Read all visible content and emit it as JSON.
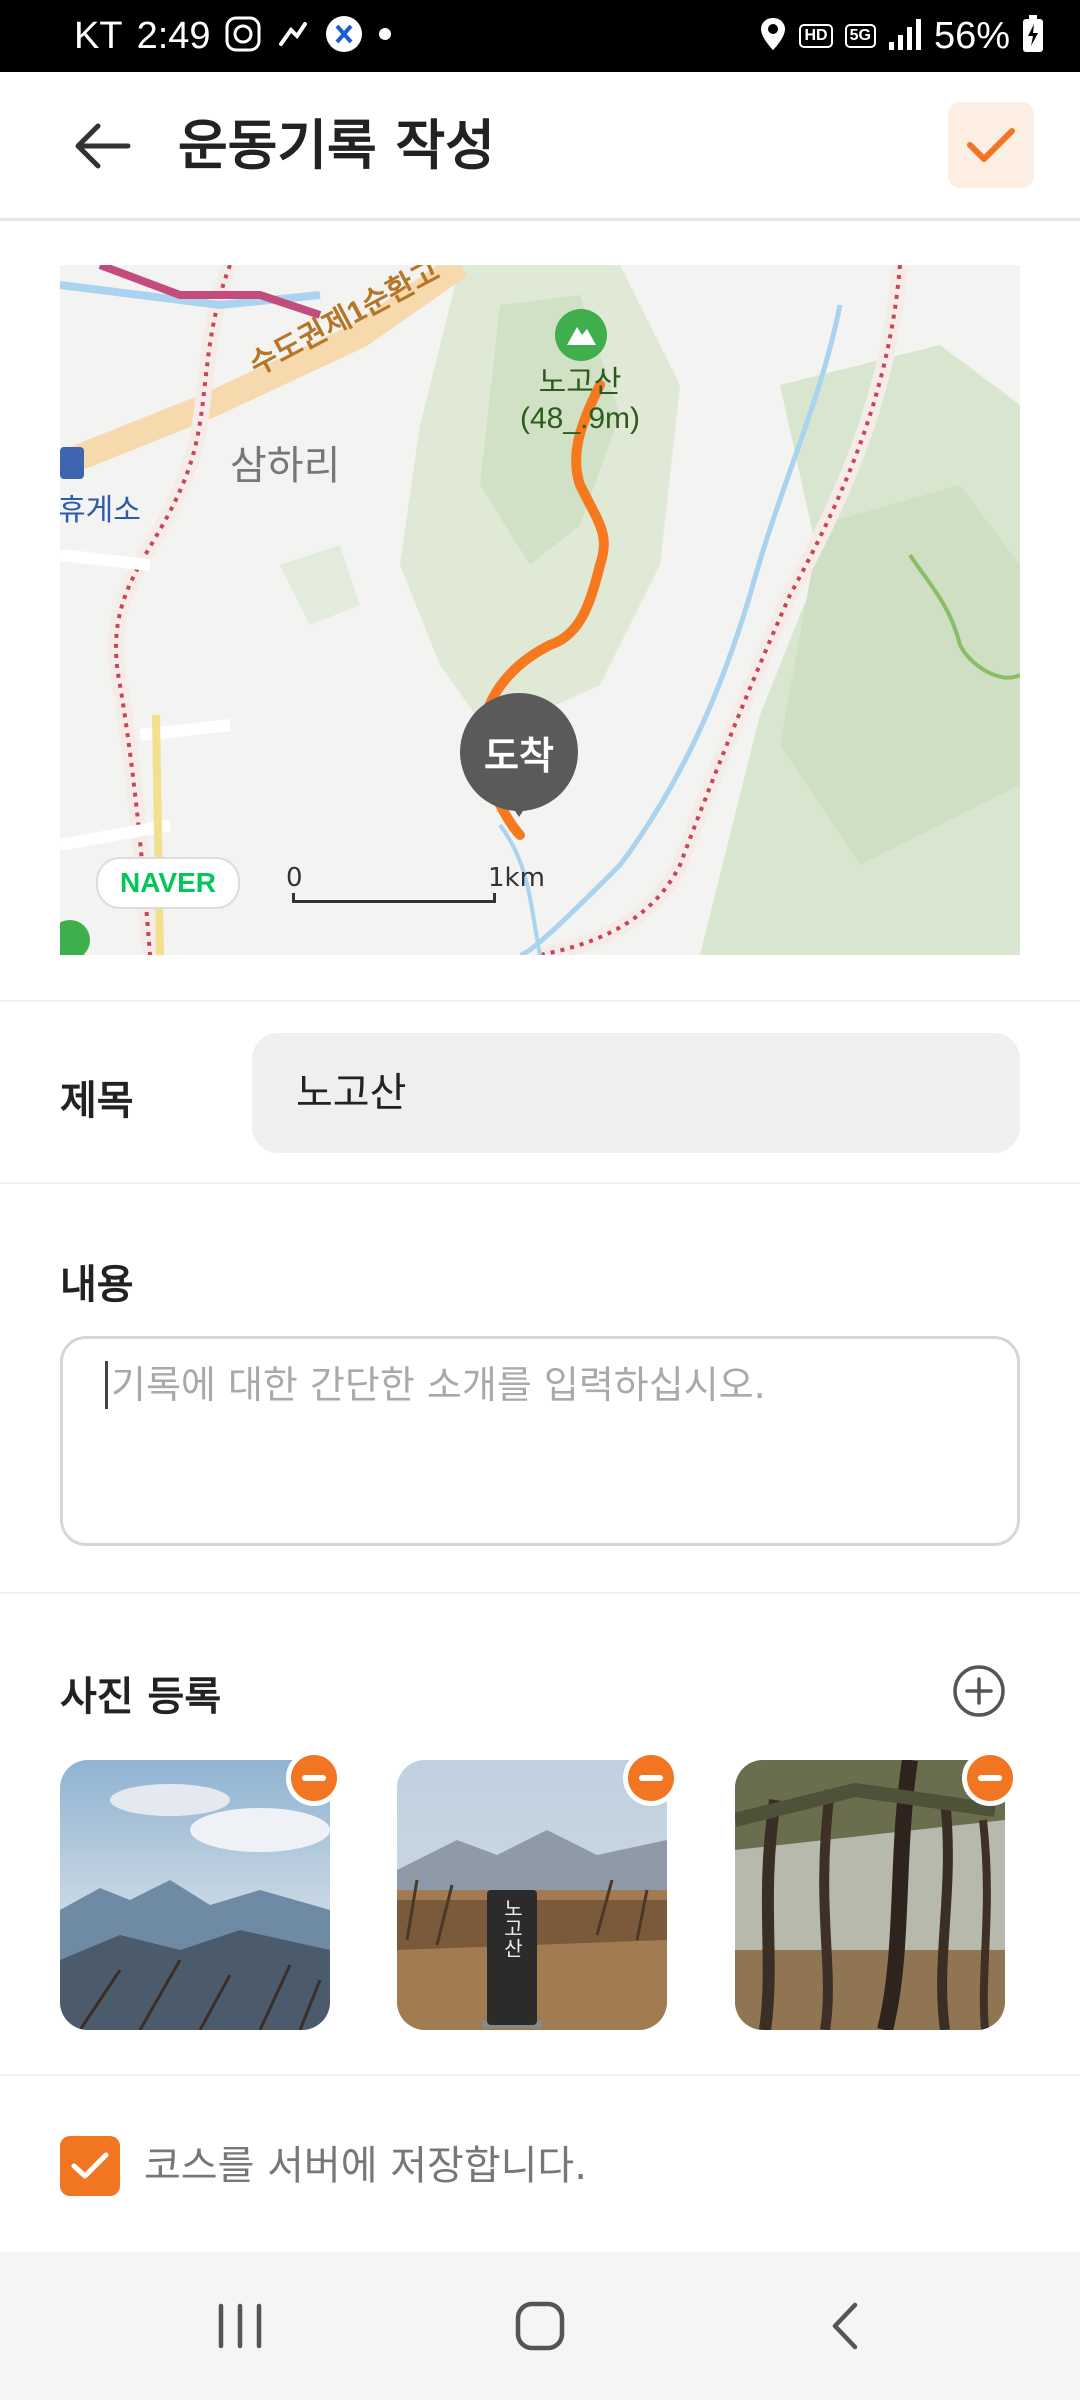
{
  "status_bar": {
    "carrier": "KT",
    "time": "2:49",
    "hd_badge": "HD",
    "network_badge": "5G",
    "battery": "56%",
    "icons": [
      "compass-app-icon",
      "hiking-app-icon",
      "x-app-icon",
      "dot-icon",
      "location-icon",
      "signal-icon",
      "battery-charging-icon"
    ]
  },
  "app_bar": {
    "title": "운동기록 작성",
    "back_icon": "arrow-left-icon",
    "confirm_icon": "check-icon",
    "accent_color": "#f27522"
  },
  "map": {
    "area_label": "삼하리",
    "highway_label": "수도권제1순환고",
    "rest_area_label": "휴게소",
    "peak_name": "노고산",
    "peak_elevation": "(48_.9m)",
    "destination_label": "도착",
    "provider": "NAVER",
    "scale_start": "0",
    "scale_end": "1km",
    "route_color": "#f6791f"
  },
  "form": {
    "title_label": "제목",
    "title_value": "노고산",
    "content_label": "내용",
    "content_placeholder": "기록에 대한 간단한 소개를 입력하십시오.",
    "photo_label": "사진 등록",
    "photo_add_icon": "plus-circle-icon",
    "photos": [
      "mountain-haze-photo",
      "summit-marker-photo",
      "pine-forest-photo"
    ],
    "summit_stone_text": "노고산",
    "save_course_label": "코스를 서버에 저장합니다.",
    "save_course_checked": true
  },
  "nav_bar": {
    "icons": [
      "recent-apps-icon",
      "home-icon",
      "back-icon"
    ]
  }
}
